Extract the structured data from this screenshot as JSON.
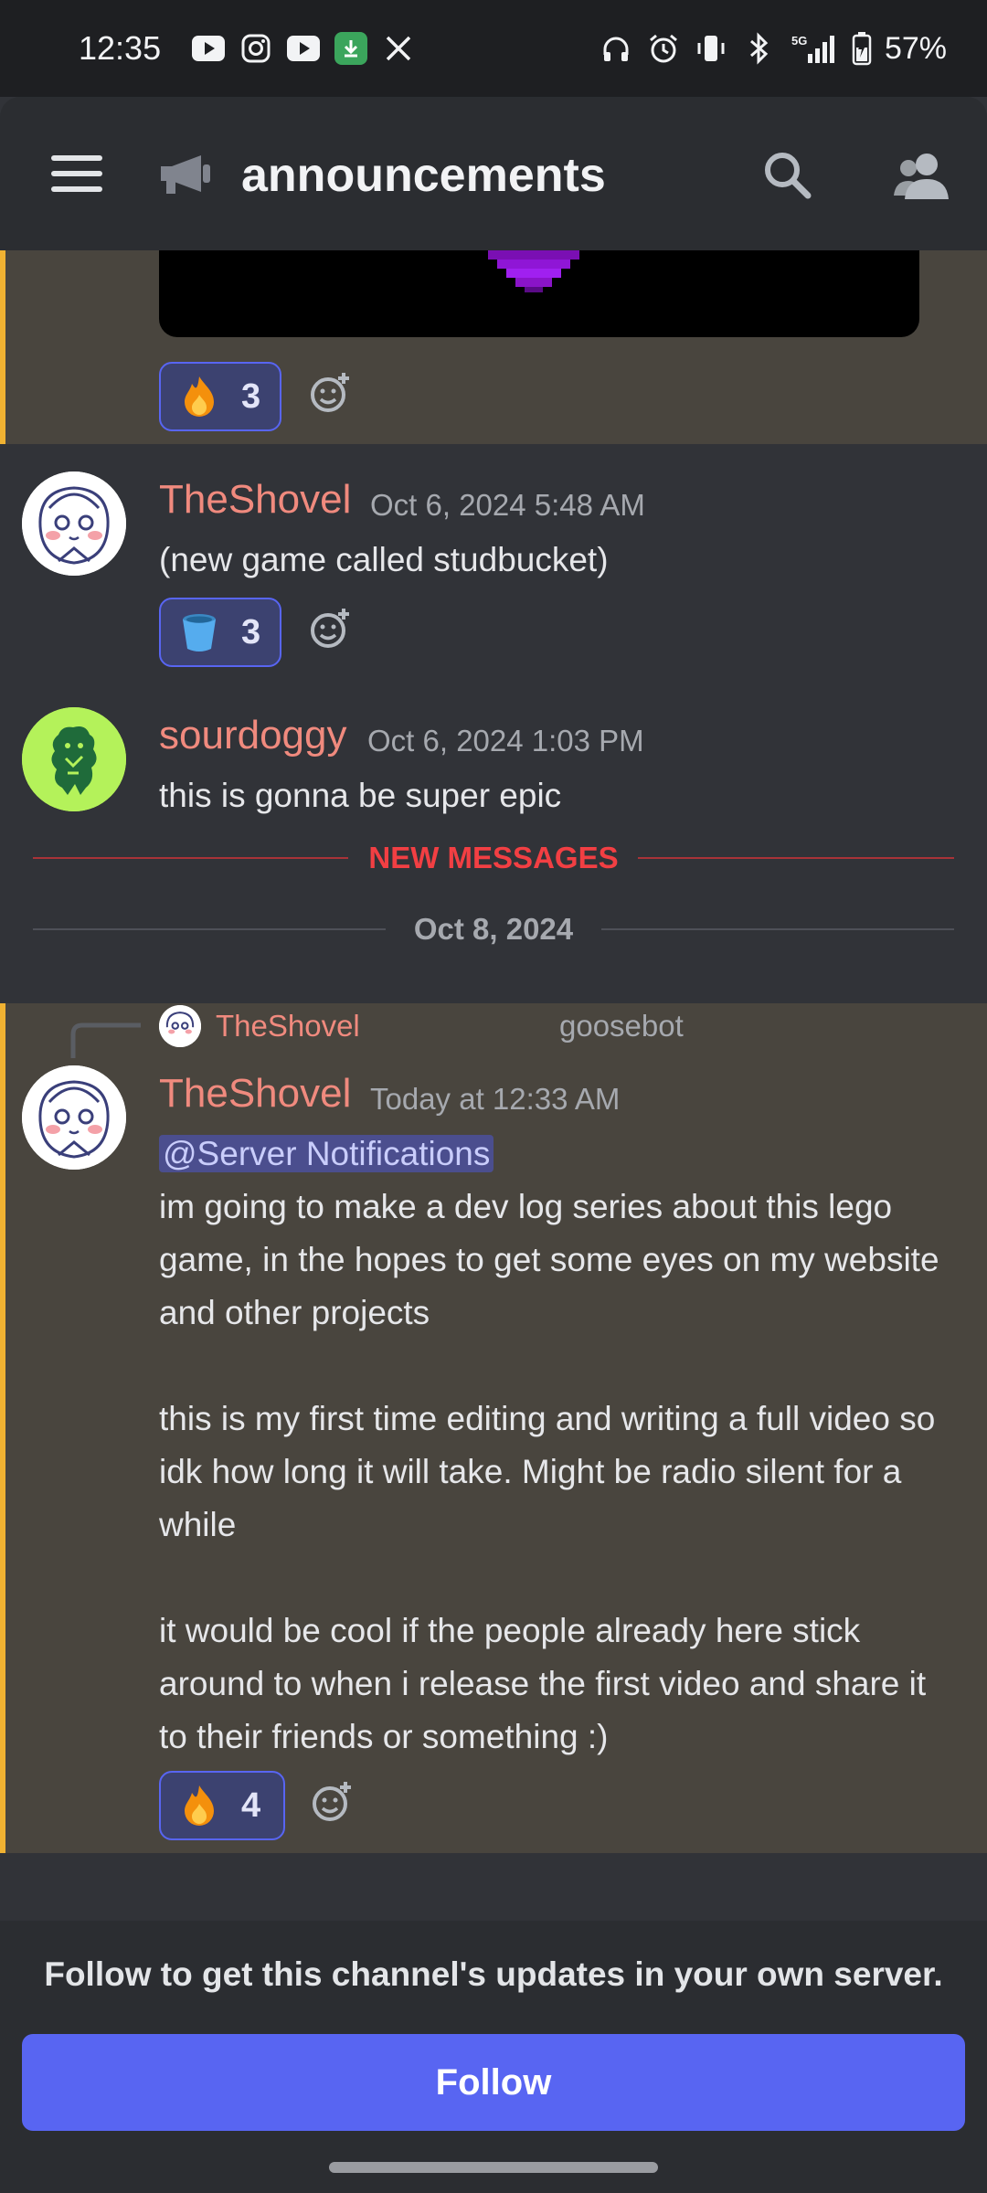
{
  "status_bar": {
    "time": "12:35",
    "network": "5G",
    "battery": "57%"
  },
  "header": {
    "channel_name": "announcements"
  },
  "reactions": {
    "msg0_count": "3",
    "msg1_count": "3",
    "msg3_count": "4"
  },
  "messages": [
    {
      "username": "TheShovel",
      "timestamp": "Oct 6, 2024 5:48 AM",
      "text": "(new game called studbucket)"
    },
    {
      "username": "sourdoggy",
      "timestamp": "Oct 6, 2024 1:03 PM",
      "text": "this is gonna be super epic"
    },
    {
      "reply_to_user": "TheShovel",
      "reply_preview": "goosebot",
      "username": "TheShovel",
      "timestamp": "Today at 12:33 AM",
      "mention": "@Server Notifications",
      "paragraph1": "im going to make a dev log series about this lego game, in the hopes to get some eyes on my website and other projects",
      "paragraph2": "this is my first time editing and writing a full video so idk how long it will take. Might be radio silent for a while",
      "paragraph3": "it would be cool if the people already here stick around to when i release the first video and share it to their friends or something :)"
    }
  ],
  "dividers": {
    "new_messages": "NEW MESSAGES",
    "date": "Oct 8, 2024"
  },
  "footer": {
    "note": "Follow to get this channel's updates in your own server.",
    "follow_label": "Follow"
  },
  "colors": {
    "accent": "#5865f2",
    "new_messages": "#f23f43",
    "highlight_bar": "#f0b232"
  }
}
